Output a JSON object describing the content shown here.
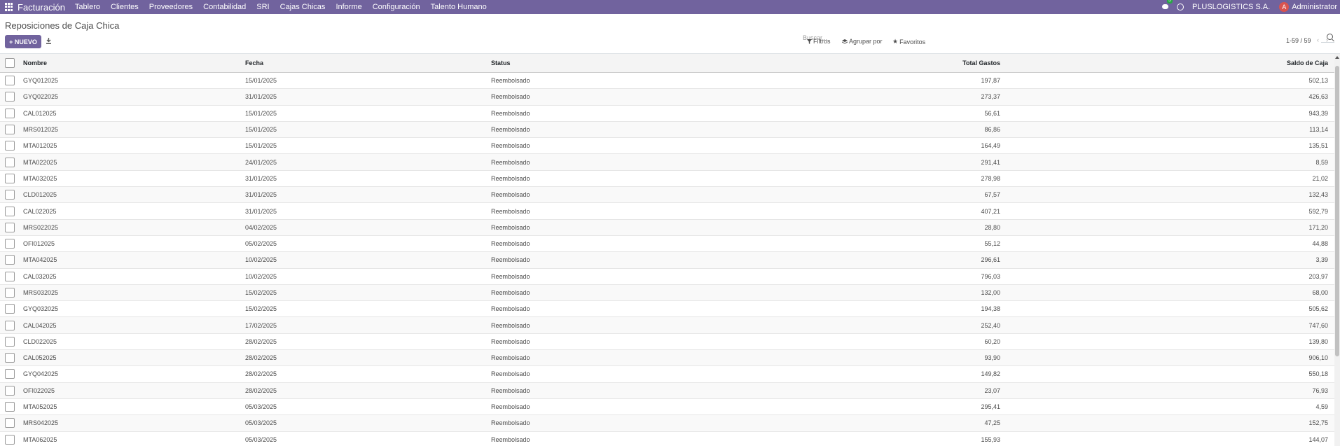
{
  "topbar": {
    "brand": "Facturación",
    "menu": [
      "Tablero",
      "Clientes",
      "Proveedores",
      "Contabilidad",
      "SRI",
      "Cajas Chicas",
      "Informe",
      "Configuración",
      "Talento Humano"
    ],
    "message_count": "5",
    "company": "PLUSLOGISTICS S.A.",
    "user_initial": "A",
    "user_name": "Administrator"
  },
  "control_panel": {
    "title": "Reposiciones de Caja Chica",
    "new_label": "+ NUEVO",
    "search_placeholder": "Buscar...",
    "filters_label": "Filtros",
    "group_by_label": "Agrupar por",
    "favorites_label": "Favoritos",
    "pager": "1-59 / 59"
  },
  "table": {
    "headers": {
      "name": "Nombre",
      "date": "Fecha",
      "status": "Status",
      "total": "Total Gastos",
      "balance": "Saldo de Caja"
    },
    "rows": [
      {
        "name": "GYQ012025",
        "date": "15/01/2025",
        "status": "Reembolsado",
        "total": "197,87",
        "balance": "502,13"
      },
      {
        "name": "GYQ022025",
        "date": "31/01/2025",
        "status": "Reembolsado",
        "total": "273,37",
        "balance": "426,63"
      },
      {
        "name": "CAL012025",
        "date": "15/01/2025",
        "status": "Reembolsado",
        "total": "56,61",
        "balance": "943,39"
      },
      {
        "name": "MRS012025",
        "date": "15/01/2025",
        "status": "Reembolsado",
        "total": "86,86",
        "balance": "113,14"
      },
      {
        "name": "MTA012025",
        "date": "15/01/2025",
        "status": "Reembolsado",
        "total": "164,49",
        "balance": "135,51"
      },
      {
        "name": "MTA022025",
        "date": "24/01/2025",
        "status": "Reembolsado",
        "total": "291,41",
        "balance": "8,59"
      },
      {
        "name": "MTA032025",
        "date": "31/01/2025",
        "status": "Reembolsado",
        "total": "278,98",
        "balance": "21,02"
      },
      {
        "name": "CLD012025",
        "date": "31/01/2025",
        "status": "Reembolsado",
        "total": "67,57",
        "balance": "132,43"
      },
      {
        "name": "CAL022025",
        "date": "31/01/2025",
        "status": "Reembolsado",
        "total": "407,21",
        "balance": "592,79"
      },
      {
        "name": "MRS022025",
        "date": "04/02/2025",
        "status": "Reembolsado",
        "total": "28,80",
        "balance": "171,20"
      },
      {
        "name": "OFI012025",
        "date": "05/02/2025",
        "status": "Reembolsado",
        "total": "55,12",
        "balance": "44,88"
      },
      {
        "name": "MTA042025",
        "date": "10/02/2025",
        "status": "Reembolsado",
        "total": "296,61",
        "balance": "3,39"
      },
      {
        "name": "CAL032025",
        "date": "10/02/2025",
        "status": "Reembolsado",
        "total": "796,03",
        "balance": "203,97"
      },
      {
        "name": "MRS032025",
        "date": "15/02/2025",
        "status": "Reembolsado",
        "total": "132,00",
        "balance": "68,00"
      },
      {
        "name": "GYQ032025",
        "date": "15/02/2025",
        "status": "Reembolsado",
        "total": "194,38",
        "balance": "505,62"
      },
      {
        "name": "CAL042025",
        "date": "17/02/2025",
        "status": "Reembolsado",
        "total": "252,40",
        "balance": "747,60"
      },
      {
        "name": "CLD022025",
        "date": "28/02/2025",
        "status": "Reembolsado",
        "total": "60,20",
        "balance": "139,80"
      },
      {
        "name": "CAL052025",
        "date": "28/02/2025",
        "status": "Reembolsado",
        "total": "93,90",
        "balance": "906,10"
      },
      {
        "name": "GYQ042025",
        "date": "28/02/2025",
        "status": "Reembolsado",
        "total": "149,82",
        "balance": "550,18"
      },
      {
        "name": "OFI022025",
        "date": "28/02/2025",
        "status": "Reembolsado",
        "total": "23,07",
        "balance": "76,93"
      },
      {
        "name": "MTA052025",
        "date": "05/03/2025",
        "status": "Reembolsado",
        "total": "295,41",
        "balance": "4,59"
      },
      {
        "name": "MRS042025",
        "date": "05/03/2025",
        "status": "Reembolsado",
        "total": "47,25",
        "balance": "152,75"
      },
      {
        "name": "MTA062025",
        "date": "05/03/2025",
        "status": "Reembolsado",
        "total": "155,93",
        "balance": "144,07"
      }
    ]
  },
  "colors": {
    "brand": "#71639e",
    "avatar": "#d9534f",
    "badge": "#28a745"
  }
}
